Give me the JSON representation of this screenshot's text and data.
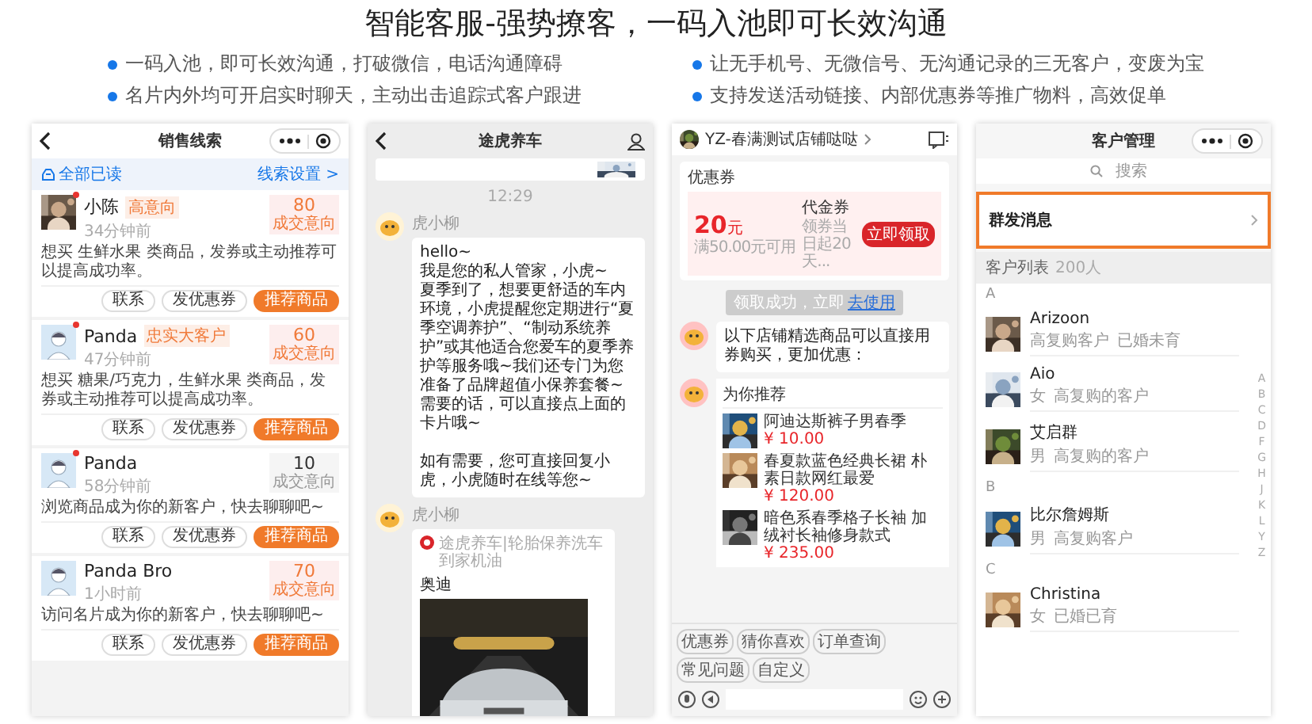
{
  "headline": "智能客服-强势撩客，一码入池即可长效沟通",
  "feature_columns": [
    [
      "一码入池，即可长效沟通，打破微信，电话沟通障碍",
      "名片内外均可开启实时聊天，主动出击追踪式客户跟进"
    ],
    [
      "让无手机号、无微信号、无沟通记录的三无客户，变废为宝",
      "支持发送活动链接、内部优惠券等推广物料，高效促单"
    ]
  ],
  "phones": [
    {
      "kind": "leads",
      "title": "销售线索",
      "read_all": "全部已读",
      "settings": "线索设置 >",
      "leads": [
        {
          "name": "小陈",
          "tag": "高意向",
          "unread": true,
          "time": "34分钟前",
          "text": "想买 生鲜水果 类商品，发券或主动推荐可以提高成功率。",
          "score": "80",
          "score_label": "成交意向",
          "hot": true,
          "actions": [
            "联系",
            "发优惠券",
            "推荐商品"
          ]
        },
        {
          "name": "Panda",
          "tag": "忠实大客户",
          "kind": "default",
          "unread": true,
          "time": "47分钟前",
          "text": "想买 糖果/巧克力，生鲜水果 类商品，发券或主动推荐可以提高成功率。",
          "score": "60",
          "score_label": "成交意向",
          "hot": true,
          "actions": [
            "联系",
            "发优惠券",
            "推荐商品"
          ]
        },
        {
          "name": "Panda",
          "kind": "default",
          "unread": true,
          "time": "58分钟前",
          "text": "浏览商品成为你的新客户，快去聊聊吧~",
          "score": "10",
          "score_label": "成交意向",
          "hot": false,
          "actions": [
            "联系",
            "发优惠券",
            "推荐商品"
          ]
        },
        {
          "name": "Panda Bro",
          "kind": "default",
          "unread": false,
          "time": "1小时前",
          "text": "访问名片成为你的新客户，快去聊聊吧~",
          "score": "70",
          "score_label": "成交意向",
          "hot": true,
          "actions": [
            "联系",
            "发优惠券",
            "推荐商品"
          ]
        }
      ]
    },
    {
      "kind": "chat",
      "title": "途虎养车",
      "time": "12:29",
      "messages": [
        {
          "kind": "text",
          "sender": "虎小柳",
          "text": "hello~\n我是您的私人管家，小虎~\n夏季到了，想要更舒适的车内环境，小虎提醒您定期进行“夏季空调养护”、“制动系统养护”或其他适合您爱车的夏季养护等服务哦~我们还专门为您准备了品牌超值小保养套餐~需要的话，可以直接点上面的卡片哦~\n\n如有需要，您可直接回复小虎，小虎随时在线等您~"
        },
        {
          "kind": "card",
          "sender": "虎小柳",
          "source": "途虎养车|轮胎保养洗车到家机油",
          "title": "奥迪"
        }
      ]
    },
    {
      "kind": "shop_chat",
      "store": "YZ-春满测试店铺哒哒",
      "coupon": {
        "label": "优惠券",
        "amount": "20",
        "unit": "元",
        "condition": "满50.00元可用",
        "type": "代金券",
        "validity": "领券当日起20天...",
        "button": "立即领取"
      },
      "notice": "领取成功，立即",
      "notice_link": "去使用",
      "message": "以下店铺精选商品可以直接用券购买，更加优惠：",
      "recommend_title": "为你推荐",
      "products": [
        {
          "name": "阿迪达斯裤子男春季",
          "price": "¥ 10.00"
        },
        {
          "name": "春夏款蓝色经典长裙 朴素日款网红最爱",
          "price": "¥ 120.00"
        },
        {
          "name": "暗色系春季格子长袖 加绒衬长袖修身款式",
          "price": "¥ 235.00"
        }
      ],
      "quick_replies": [
        "优惠券",
        "猜你喜欢",
        "订单查询",
        "常见问题",
        "自定义"
      ]
    },
    {
      "kind": "contacts",
      "title": "客户管理",
      "search_placeholder": "搜索",
      "broadcast": {
        "label": "群发消息",
        "highlighted": true
      },
      "list_label": "客户列表",
      "count": "200人",
      "groups": [
        {
          "letter": "A",
          "contacts": [
            {
              "name": "Arizoon",
              "tags": [
                "高复购客户",
                "已婚未育"
              ]
            },
            {
              "name": "Aio",
              "tags": [
                "女",
                "高复购的客户"
              ]
            },
            {
              "name": "艾启群",
              "tags": [
                "男",
                "高复购的客户"
              ]
            }
          ]
        },
        {
          "letter": "B",
          "contacts": [
            {
              "name": "比尔詹姆斯",
              "tags": [
                "男",
                "高复购客户"
              ]
            }
          ]
        },
        {
          "letter": "C",
          "contacts": [
            {
              "name": "Christina",
              "tags": [
                "女",
                "已婚已育"
              ]
            }
          ]
        }
      ],
      "index": [
        "A",
        "B",
        "C",
        "D",
        "F",
        "G",
        "H",
        "J",
        "K",
        "L",
        "Y",
        "Z"
      ]
    }
  ]
}
